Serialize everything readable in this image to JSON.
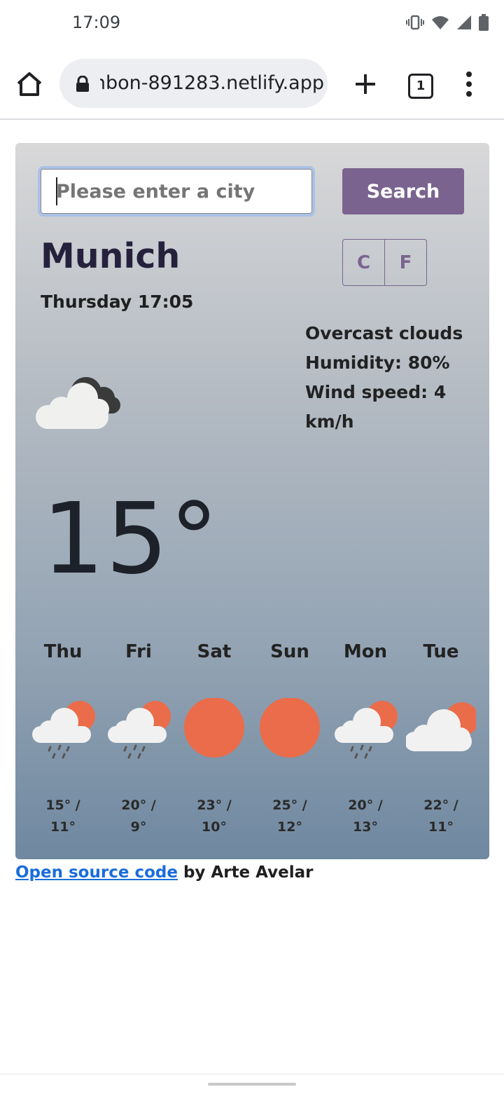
{
  "status_bar": {
    "time": "17:09"
  },
  "browser": {
    "url": "onbon-891283.netlify.app",
    "tab_count": "1"
  },
  "search": {
    "placeholder": "Please enter a city",
    "button_label": "Search"
  },
  "weather": {
    "city": "Munich",
    "date_time": "Thursday 17:05",
    "description": "Overcast clouds",
    "humidity": "Humidity: 80%",
    "wind": "Wind speed: 4 km/h",
    "temperature": "15°",
    "main_icon": "overcast-clouds-icon",
    "units": {
      "celsius": "C",
      "fahrenheit": "F"
    }
  },
  "forecast": [
    {
      "day": "Thu",
      "temps": "15° / 11°",
      "max": "15° /",
      "min": "11°",
      "icon": "rain-sun-icon"
    },
    {
      "day": "Fri",
      "temps": "20° / 9°",
      "max": "20° /",
      "min": "9°",
      "icon": "rain-sun-icon"
    },
    {
      "day": "Sat",
      "temps": "23° / 10°",
      "max": "23° /",
      "min": "10°",
      "icon": "sun-icon"
    },
    {
      "day": "Sun",
      "temps": "25° / 12°",
      "max": "25° /",
      "min": "12°",
      "icon": "sun-icon"
    },
    {
      "day": "Mon",
      "temps": "20° / 13°",
      "max": "20° /",
      "min": "13°",
      "icon": "rain-sun-icon"
    },
    {
      "day": "Tue",
      "temps": "22° / 11°",
      "max": "22° /",
      "min": "11°",
      "icon": "cloud-sun-icon"
    }
  ],
  "footer": {
    "link_text": "Open source code",
    "byline": " by Arte Avelar"
  },
  "colors": {
    "accent": "#7a648f",
    "sun": "#ea6c4a",
    "link": "#1a6ddb"
  }
}
